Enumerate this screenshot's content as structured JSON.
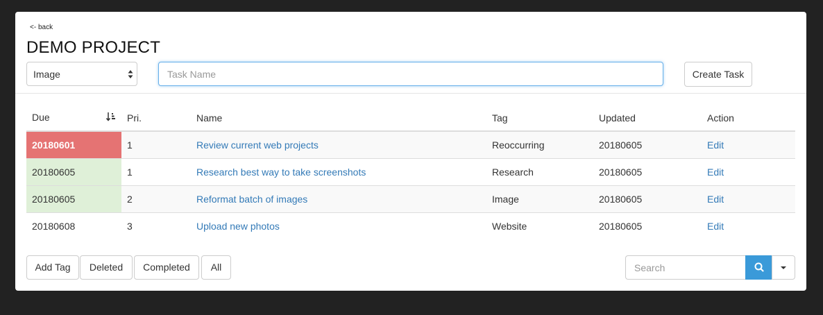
{
  "nav": {
    "back_label": "<- back"
  },
  "project": {
    "title": "DEMO PROJECT"
  },
  "toolbar": {
    "type_select_value": "Image",
    "task_name_placeholder": "Task Name",
    "create_label": "Create Task"
  },
  "table": {
    "headers": {
      "due": "Due",
      "priority": "Pri.",
      "name": "Name",
      "tag": "Tag",
      "updated": "Updated",
      "action": "Action"
    },
    "rows": [
      {
        "due": "20180601",
        "priority": "1",
        "name": "Review current web projects",
        "tag": "Reoccurring",
        "updated": "20180605",
        "action": "Edit",
        "status": "overdue"
      },
      {
        "due": "20180605",
        "priority": "1",
        "name": "Research best way to take screenshots",
        "tag": "Research",
        "updated": "20180605",
        "action": "Edit",
        "status": "due-today"
      },
      {
        "due": "20180605",
        "priority": "2",
        "name": "Reformat batch of images",
        "tag": "Image",
        "updated": "20180605",
        "action": "Edit",
        "status": "due-today"
      },
      {
        "due": "20180608",
        "priority": "3",
        "name": "Upload new photos",
        "tag": "Website",
        "updated": "20180605",
        "action": "Edit",
        "status": "normal"
      }
    ]
  },
  "footer": {
    "add_tag_label": "Add Tag",
    "deleted_label": "Deleted",
    "completed_label": "Completed",
    "all_label": "All",
    "search_placeholder": "Search"
  },
  "colors": {
    "overdue": "#e57373",
    "due_today": "#dff0d8",
    "link": "#337ab7",
    "search_button": "#3a9ad9"
  },
  "icons": {
    "sort": "sort-ascending-icon",
    "search": "search-icon",
    "dropdown": "caret-down-icon",
    "select": "select-arrows-icon"
  }
}
